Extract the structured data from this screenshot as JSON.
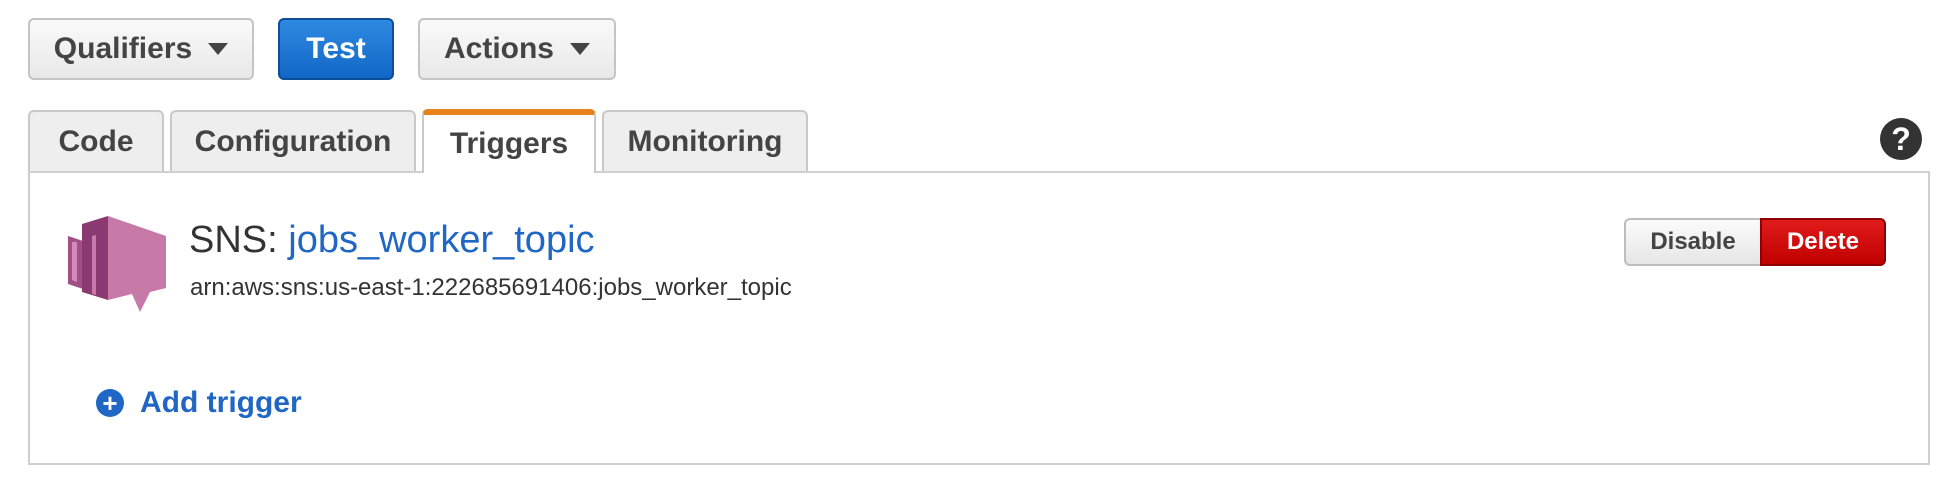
{
  "toolbar": {
    "qualifiers_label": "Qualifiers",
    "test_label": "Test",
    "actions_label": "Actions"
  },
  "tabs": [
    {
      "label": "Code"
    },
    {
      "label": "Configuration"
    },
    {
      "label": "Triggers",
      "active": true
    },
    {
      "label": "Monitoring"
    }
  ],
  "help": {
    "symbol": "?"
  },
  "trigger": {
    "service_prefix": "SNS: ",
    "topic_name": "jobs_worker_topic",
    "arn": "arn:aws:sns:us-east-1:222685691406:jobs_worker_topic",
    "icon": "sns-topic-icon",
    "disable_label": "Disable",
    "delete_label": "Delete"
  },
  "add_trigger": {
    "label": "Add trigger",
    "icon": "plus-circle-icon"
  },
  "colors": {
    "accent": "#e8821a",
    "primary": "#1f66c5",
    "danger": "#c00000",
    "sns_icon": "#c77aa8"
  }
}
